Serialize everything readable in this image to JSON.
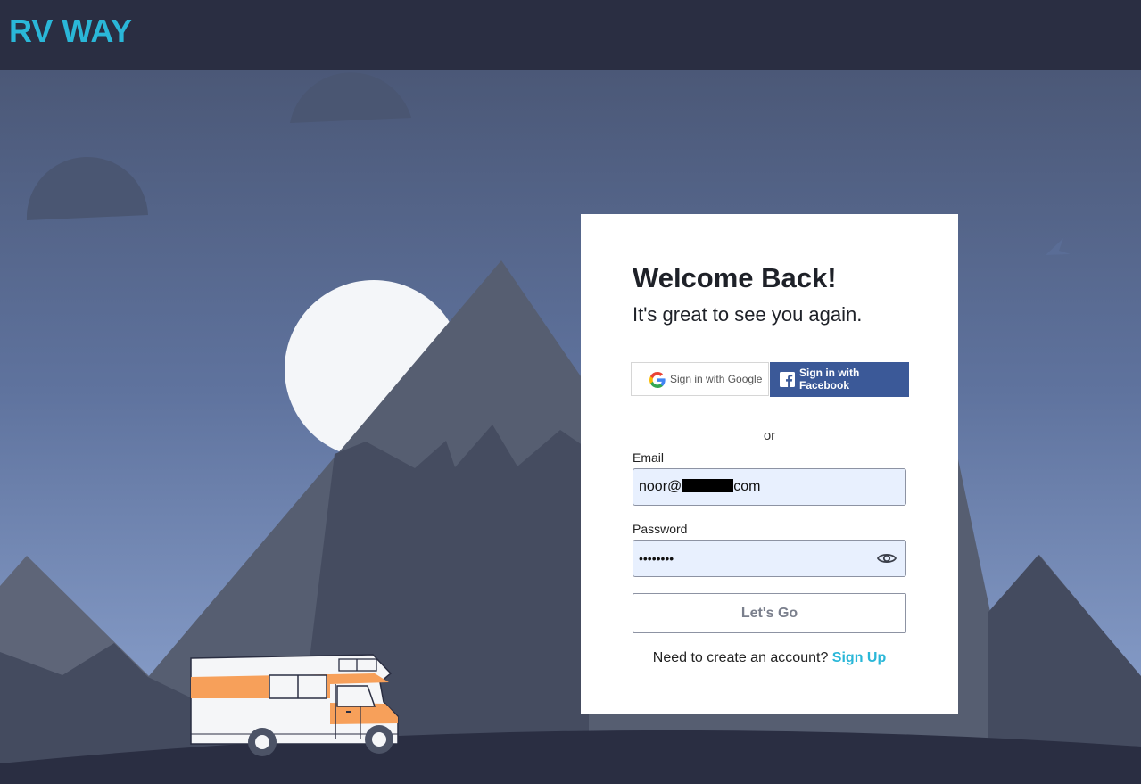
{
  "header": {
    "brand": "RV WAY",
    "brand_color": "#2ab7d8",
    "background_color": "#2a2e42"
  },
  "login": {
    "title": "Welcome Back!",
    "subtitle": "It's great to see you again.",
    "google_label": "Sign in with Google",
    "facebook_label": "Sign in with Facebook",
    "or_text": "or",
    "email_label": "Email",
    "email_prefix": "noor@",
    "email_suffix": "com",
    "password_label": "Password",
    "password_value": "••••••••",
    "submit_label": "Let's Go",
    "signup_prompt": "Need to create an account?",
    "signup_link": "Sign Up"
  },
  "icons": {
    "google": "google-icon",
    "facebook": "facebook-icon",
    "password_toggle": "eye-icon",
    "rv": "rv-camper-illustration"
  },
  "colors": {
    "accent": "#2ab7d8",
    "facebook": "#3b5998",
    "input_fill": "#e8f0fe"
  }
}
